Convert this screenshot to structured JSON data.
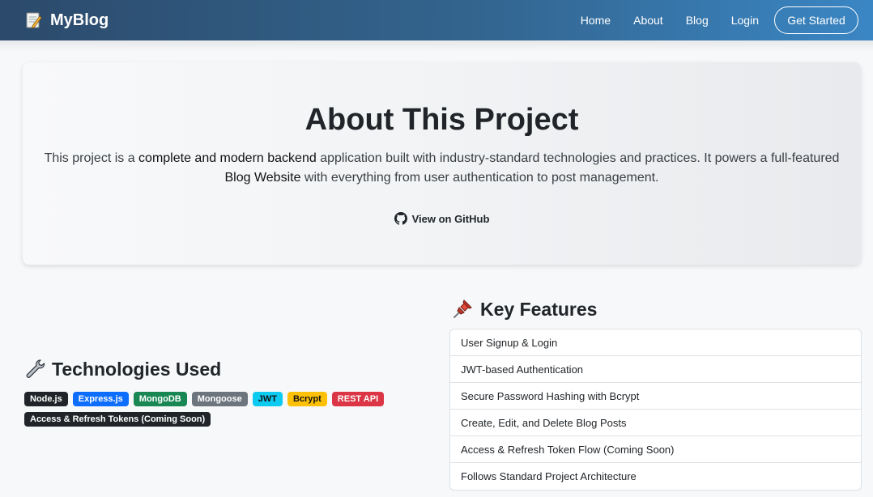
{
  "nav": {
    "brand_name": "MyBlog",
    "brand_icon": "memo-icon",
    "links": [
      {
        "label": "Home"
      },
      {
        "label": "About"
      },
      {
        "label": "Blog"
      },
      {
        "label": "Login"
      }
    ],
    "cta_label": "Get Started"
  },
  "hero": {
    "title": "About This Project",
    "desc_1": "This project is a ",
    "desc_bold_1": "complete and modern backend",
    "desc_2": " application built with industry-standard technologies and practices. It powers a full-featured ",
    "desc_bold_2": "Blog Website",
    "desc_3": " with everything from user authentication to post management.",
    "github_label": "View on GitHub"
  },
  "tech": {
    "heading": "Technologies Used",
    "badges": [
      {
        "label": "Node.js",
        "color": "#212529"
      },
      {
        "label": "Express.js",
        "color": "#0d6efd"
      },
      {
        "label": "MongoDB",
        "color": "#198754"
      },
      {
        "label": "Mongoose",
        "color": "#6c757d"
      },
      {
        "label": "JWT",
        "color": "#0dcaf0"
      },
      {
        "label": "Bcrypt",
        "color": "#ffc107"
      },
      {
        "label": "REST API",
        "color": "#dc3545"
      },
      {
        "label": "Access & Refresh Tokens (Coming Soon)",
        "color": "#212529"
      }
    ]
  },
  "features": {
    "heading": "Key Features",
    "items": [
      "User Signup & Login",
      "JWT-based Authentication",
      "Secure Password Hashing with Bcrypt",
      "Create, Edit, and Delete Blog Posts",
      "Access & Refresh Token Flow (Coming Soon)",
      "Follows Standard Project Architecture"
    ]
  },
  "colors": {
    "nav_gradient_start": "#2c4a6b",
    "nav_gradient_end": "#3a86c4"
  }
}
